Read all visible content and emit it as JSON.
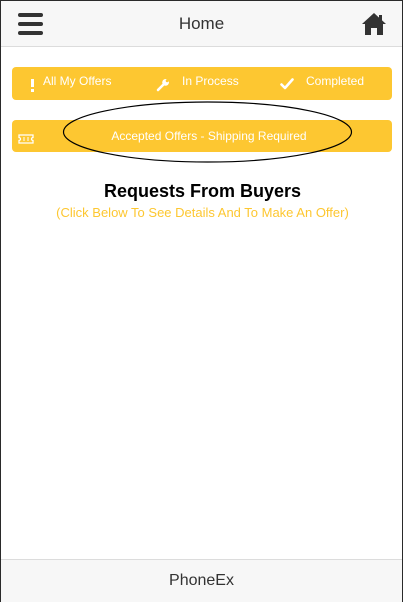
{
  "header": {
    "title": "Home",
    "menu_icon": "hamburger-menu-icon",
    "home_icon": "home-icon"
  },
  "tabs": [
    {
      "label": "All My Offers",
      "icon": "exclamation-icon"
    },
    {
      "label": "In Process",
      "icon": "wrench-icon"
    },
    {
      "label": "Completed",
      "icon": "checkmark-icon"
    }
  ],
  "shipping_bar": {
    "label": "Accepted Offers - Shipping Required",
    "icon": "ticket-icon"
  },
  "main": {
    "title": "Requests From Buyers",
    "subtitle": "(Click Below To See Details And To Make An Offer)"
  },
  "footer": {
    "title": "PhoneEx"
  },
  "colors": {
    "accent": "#fdc731",
    "header_bg": "#f7f7f7",
    "text_dark": "#333333",
    "annotation_stroke": "#000000"
  }
}
